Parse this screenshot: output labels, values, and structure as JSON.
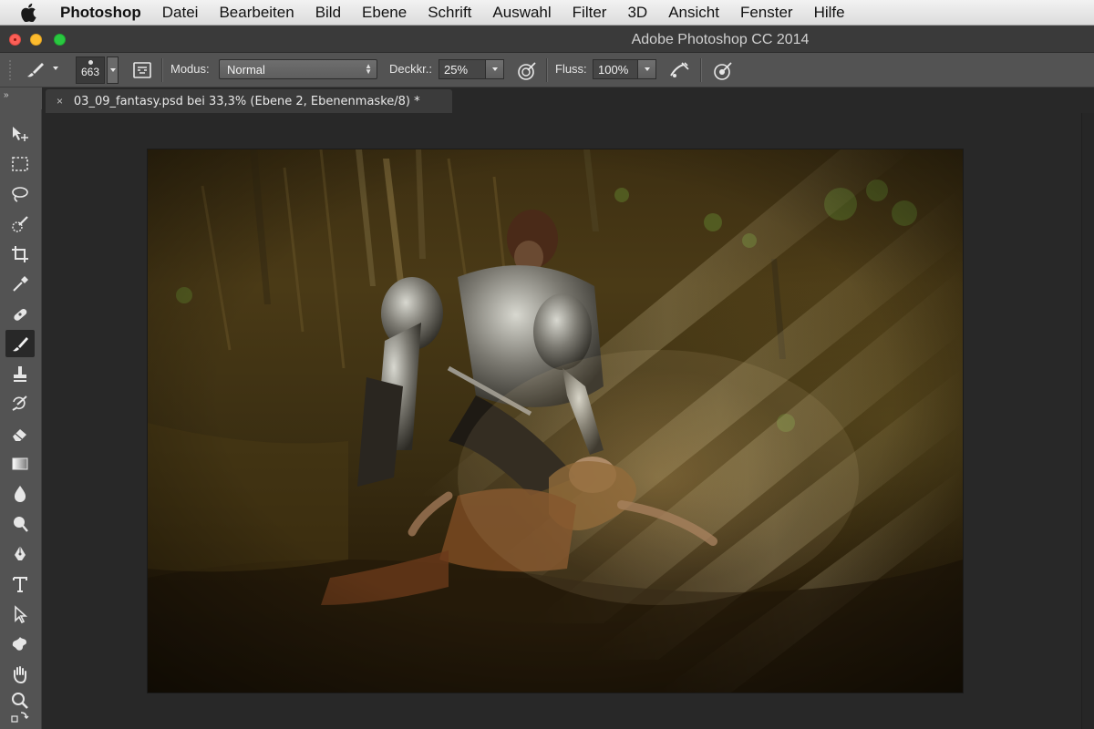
{
  "menubar": {
    "app_name": "Photoshop",
    "items": [
      "Datei",
      "Bearbeiten",
      "Bild",
      "Ebene",
      "Schrift",
      "Auswahl",
      "Filter",
      "3D",
      "Ansicht",
      "Fenster",
      "Hilfe"
    ]
  },
  "window": {
    "title": "Adobe Photoshop CC 2014"
  },
  "options_bar": {
    "brush_size": "663",
    "mode_label": "Modus:",
    "mode_value": "Normal",
    "opacity_label": "Deckkr.:",
    "opacity_value": "25%",
    "flow_label": "Fluss:",
    "flow_value": "100%"
  },
  "tool_strip": {
    "collapse_glyph": "»"
  },
  "document": {
    "tab_close": "×",
    "tab_title": "03_09_fantasy.psd bei 33,3% (Ebene 2, Ebenenmaske/8) *"
  },
  "tools": [
    {
      "name": "move-tool-icon"
    },
    {
      "name": "marquee-tool-icon"
    },
    {
      "name": "lasso-tool-icon"
    },
    {
      "name": "quick-selection-tool-icon"
    },
    {
      "name": "crop-tool-icon"
    },
    {
      "name": "eyedropper-tool-icon"
    },
    {
      "name": "healing-brush-tool-icon"
    },
    {
      "name": "brush-tool-icon",
      "active": true
    },
    {
      "name": "clone-stamp-tool-icon"
    },
    {
      "name": "history-brush-tool-icon"
    },
    {
      "name": "eraser-tool-icon"
    },
    {
      "name": "gradient-tool-icon"
    },
    {
      "name": "blur-tool-icon"
    },
    {
      "name": "dodge-tool-icon"
    },
    {
      "name": "pen-tool-icon"
    },
    {
      "name": "type-tool-icon"
    },
    {
      "name": "path-selection-tool-icon"
    },
    {
      "name": "custom-shape-tool-icon"
    },
    {
      "name": "hand-tool-icon"
    },
    {
      "name": "zoom-tool-icon"
    },
    {
      "name": "color-swap-icon"
    }
  ],
  "colors": {
    "menubar_bg": "#e6e6e6",
    "panel_bg": "#535353",
    "workspace_bg": "#282828",
    "titlebar_bg": "#3a3a3a",
    "traffic_red": "#fc5f57",
    "traffic_yellow": "#fdbc2e",
    "traffic_green": "#29c840"
  }
}
